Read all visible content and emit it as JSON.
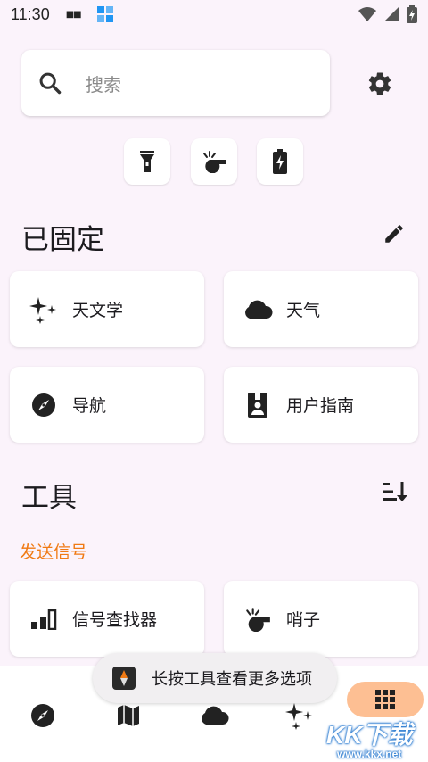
{
  "status_bar": {
    "time": "11:30",
    "notif_dots": "■■"
  },
  "search": {
    "placeholder": "搜索"
  },
  "pinned": {
    "title": "已固定",
    "cards": [
      {
        "label": "天文学",
        "icon": "sparkles-icon"
      },
      {
        "label": "天气",
        "icon": "cloud-icon"
      },
      {
        "label": "导航",
        "icon": "compass-icon"
      },
      {
        "label": "用户指南",
        "icon": "guide-book-icon"
      }
    ]
  },
  "tools": {
    "title": "工具",
    "category": "发送信号",
    "cards": [
      {
        "label": "信号查找器",
        "icon": "signal-bars-icon"
      },
      {
        "label": "哨子",
        "icon": "whistle-icon"
      }
    ]
  },
  "quick_actions": [
    "flashlight-icon",
    "whistle-icon",
    "battery-icon"
  ],
  "bottom_nav": [
    "compass-icon",
    "map-icon",
    "cloud-icon",
    "sparkles-icon",
    "grid-icon"
  ],
  "toast": {
    "text": "长按工具查看更多选项"
  },
  "watermark": {
    "big": "KK下载",
    "small": "www.kkx.net"
  },
  "colors": {
    "accent": "#f07a14",
    "fab": "#fdbf93",
    "background": "#fbf3fb"
  }
}
